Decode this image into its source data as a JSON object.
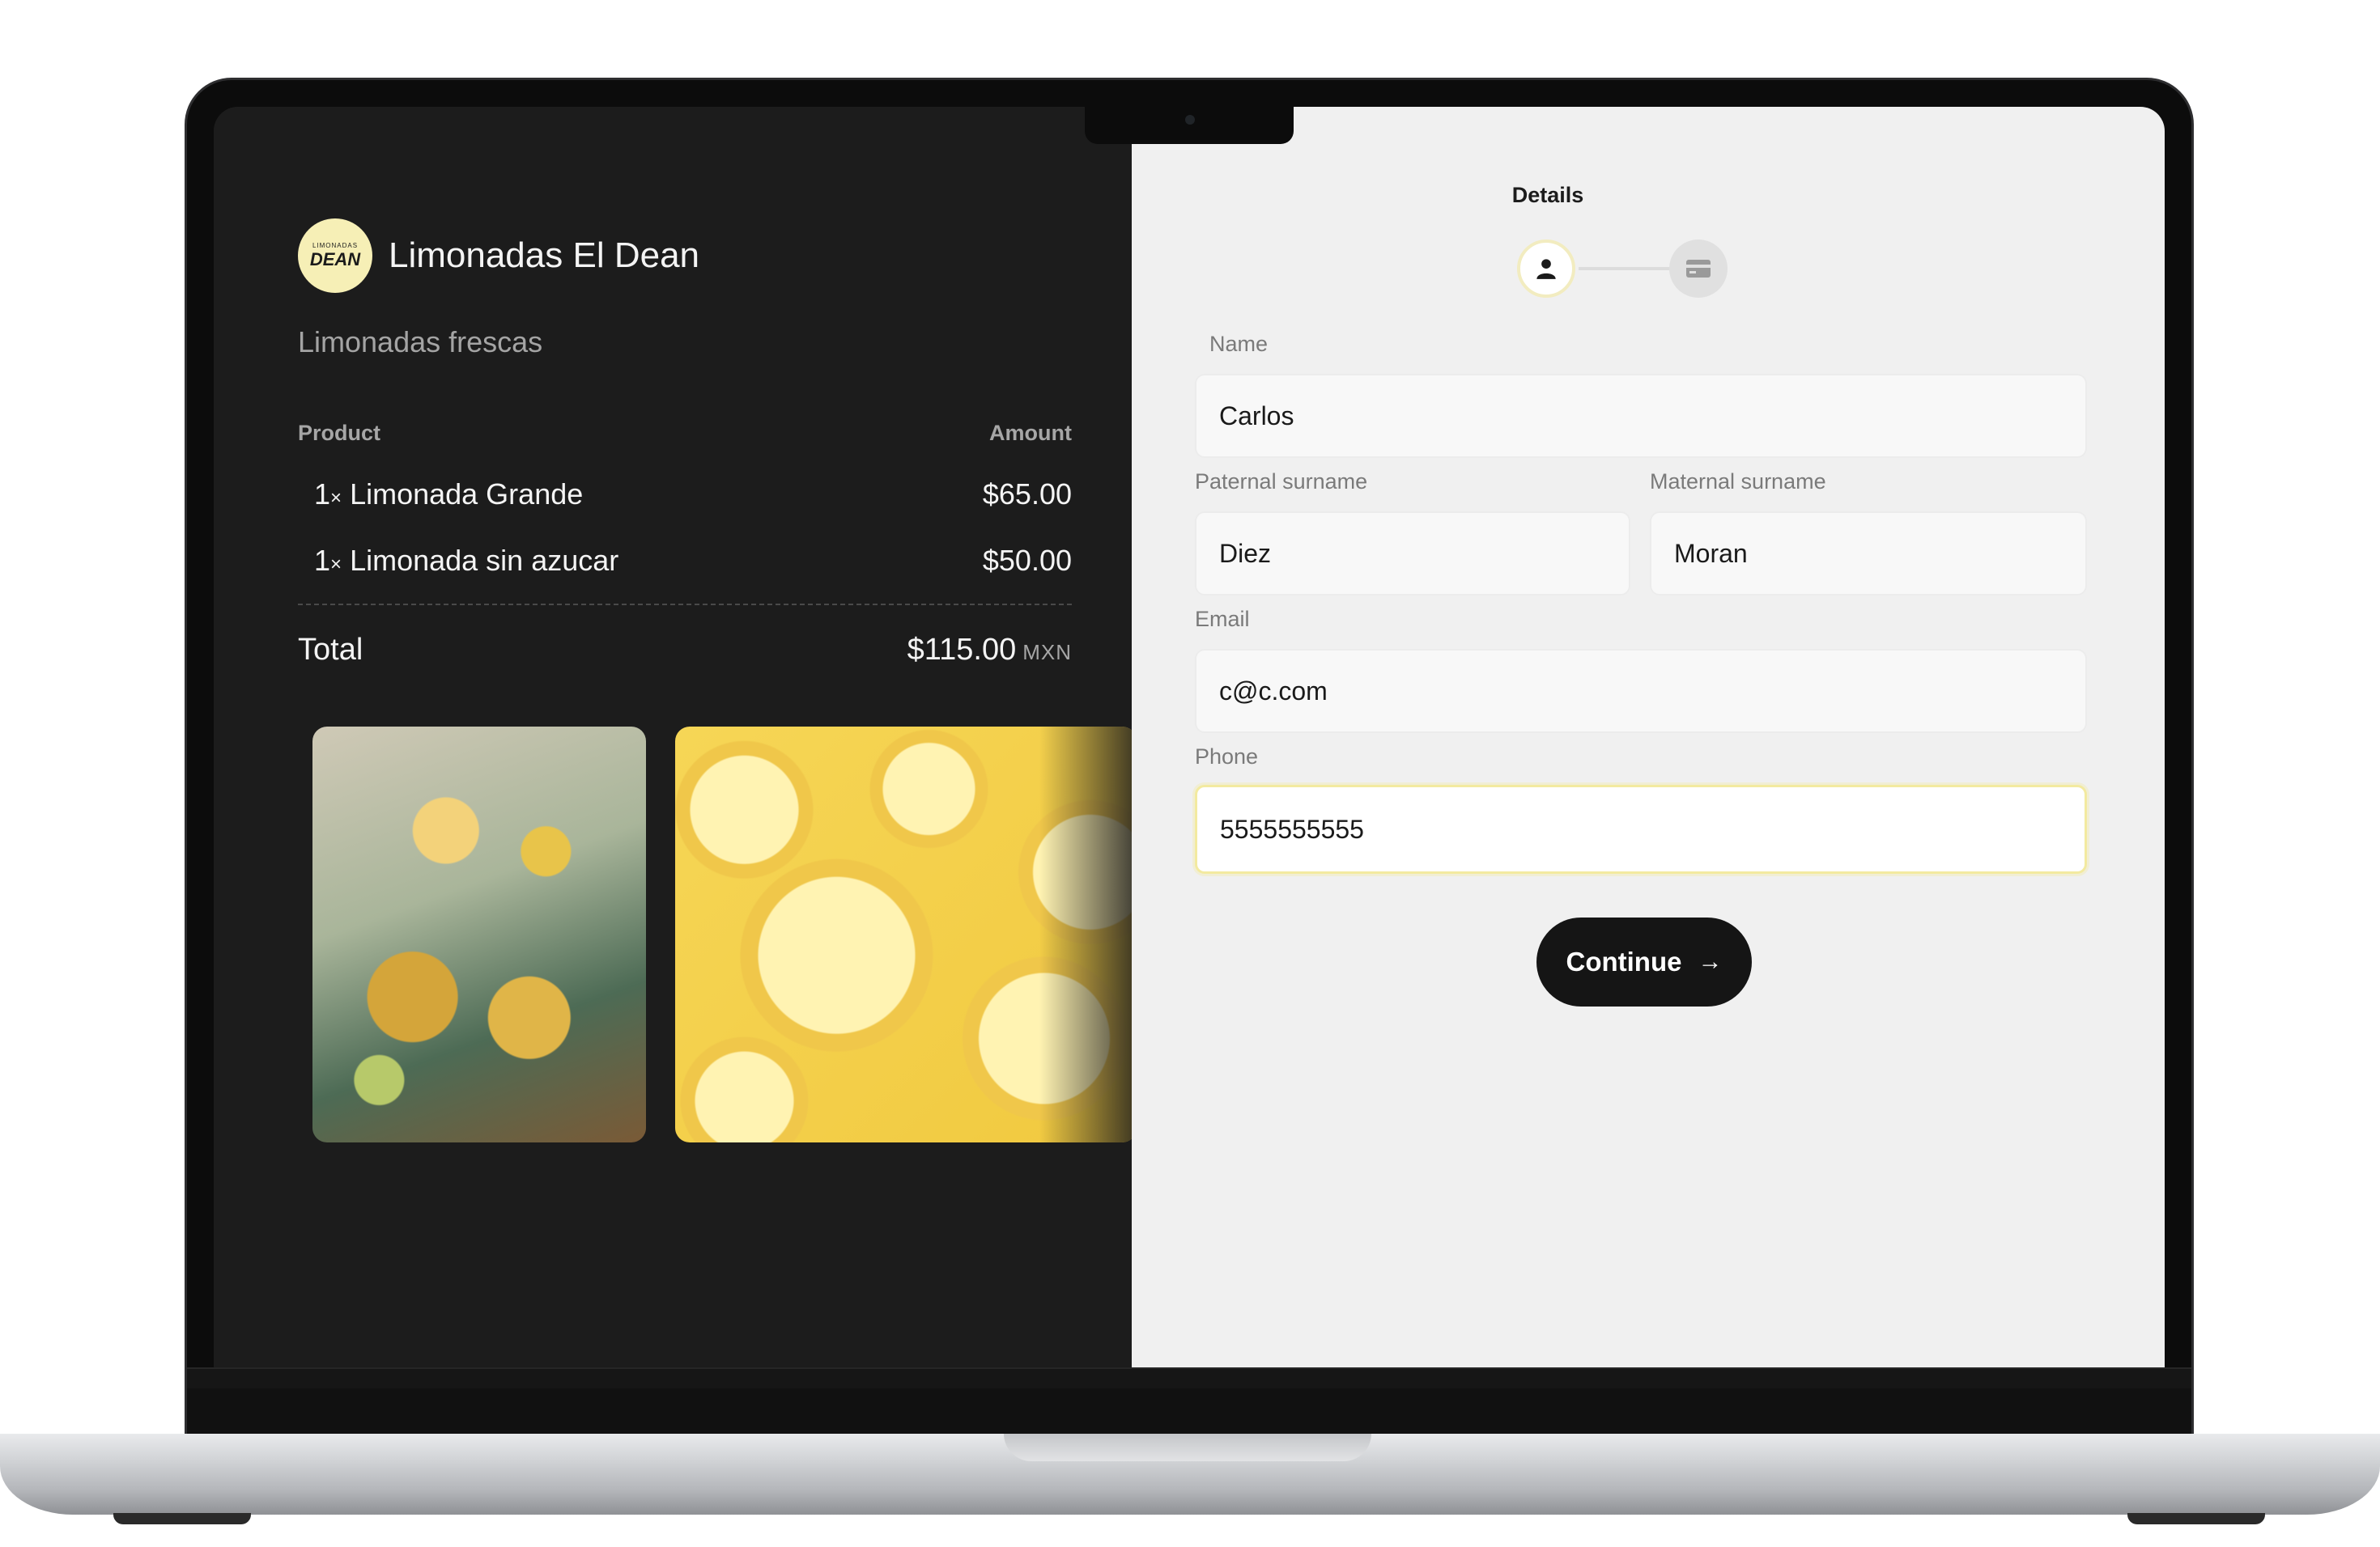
{
  "merchant": {
    "name": "Limonadas El Dean",
    "logo_text_small": "LIMONADAS",
    "logo_text_big": "DEAN",
    "tagline": "Limonadas frescas"
  },
  "summary": {
    "product_header": "Product",
    "amount_header": "Amount",
    "items": [
      {
        "qty": "1",
        "x": "×",
        "name": "Limonada Grande",
        "amount": "$65.00"
      },
      {
        "qty": "1",
        "x": "×",
        "name": "Limonada sin azucar",
        "amount": "$50.00"
      }
    ],
    "total_label": "Total",
    "total_amount": "$115.00",
    "currency": "MXN"
  },
  "images": [
    {
      "icon": "lemonade-photo"
    },
    {
      "icon": "lemon-slices-photo"
    }
  ],
  "stepper": {
    "title": "Details",
    "steps": [
      {
        "icon": "user-icon",
        "active": true
      },
      {
        "icon": "card-icon",
        "active": false
      }
    ]
  },
  "form": {
    "name": {
      "label": "Name",
      "value": "Carlos"
    },
    "paternal_surname": {
      "label": "Paternal surname",
      "value": "Diez"
    },
    "maternal_surname": {
      "label": "Maternal surname",
      "value": "Moran"
    },
    "email": {
      "label": "Email",
      "value": "c@c.com"
    },
    "phone": {
      "label": "Phone",
      "value": "5555555555"
    },
    "continue_label": "Continue",
    "continue_icon": "arrow-right-icon"
  },
  "colors": {
    "left_bg": "#1c1c1c",
    "right_bg": "#f0f0f0",
    "accent": "#f6efb6",
    "button": "#151515"
  }
}
